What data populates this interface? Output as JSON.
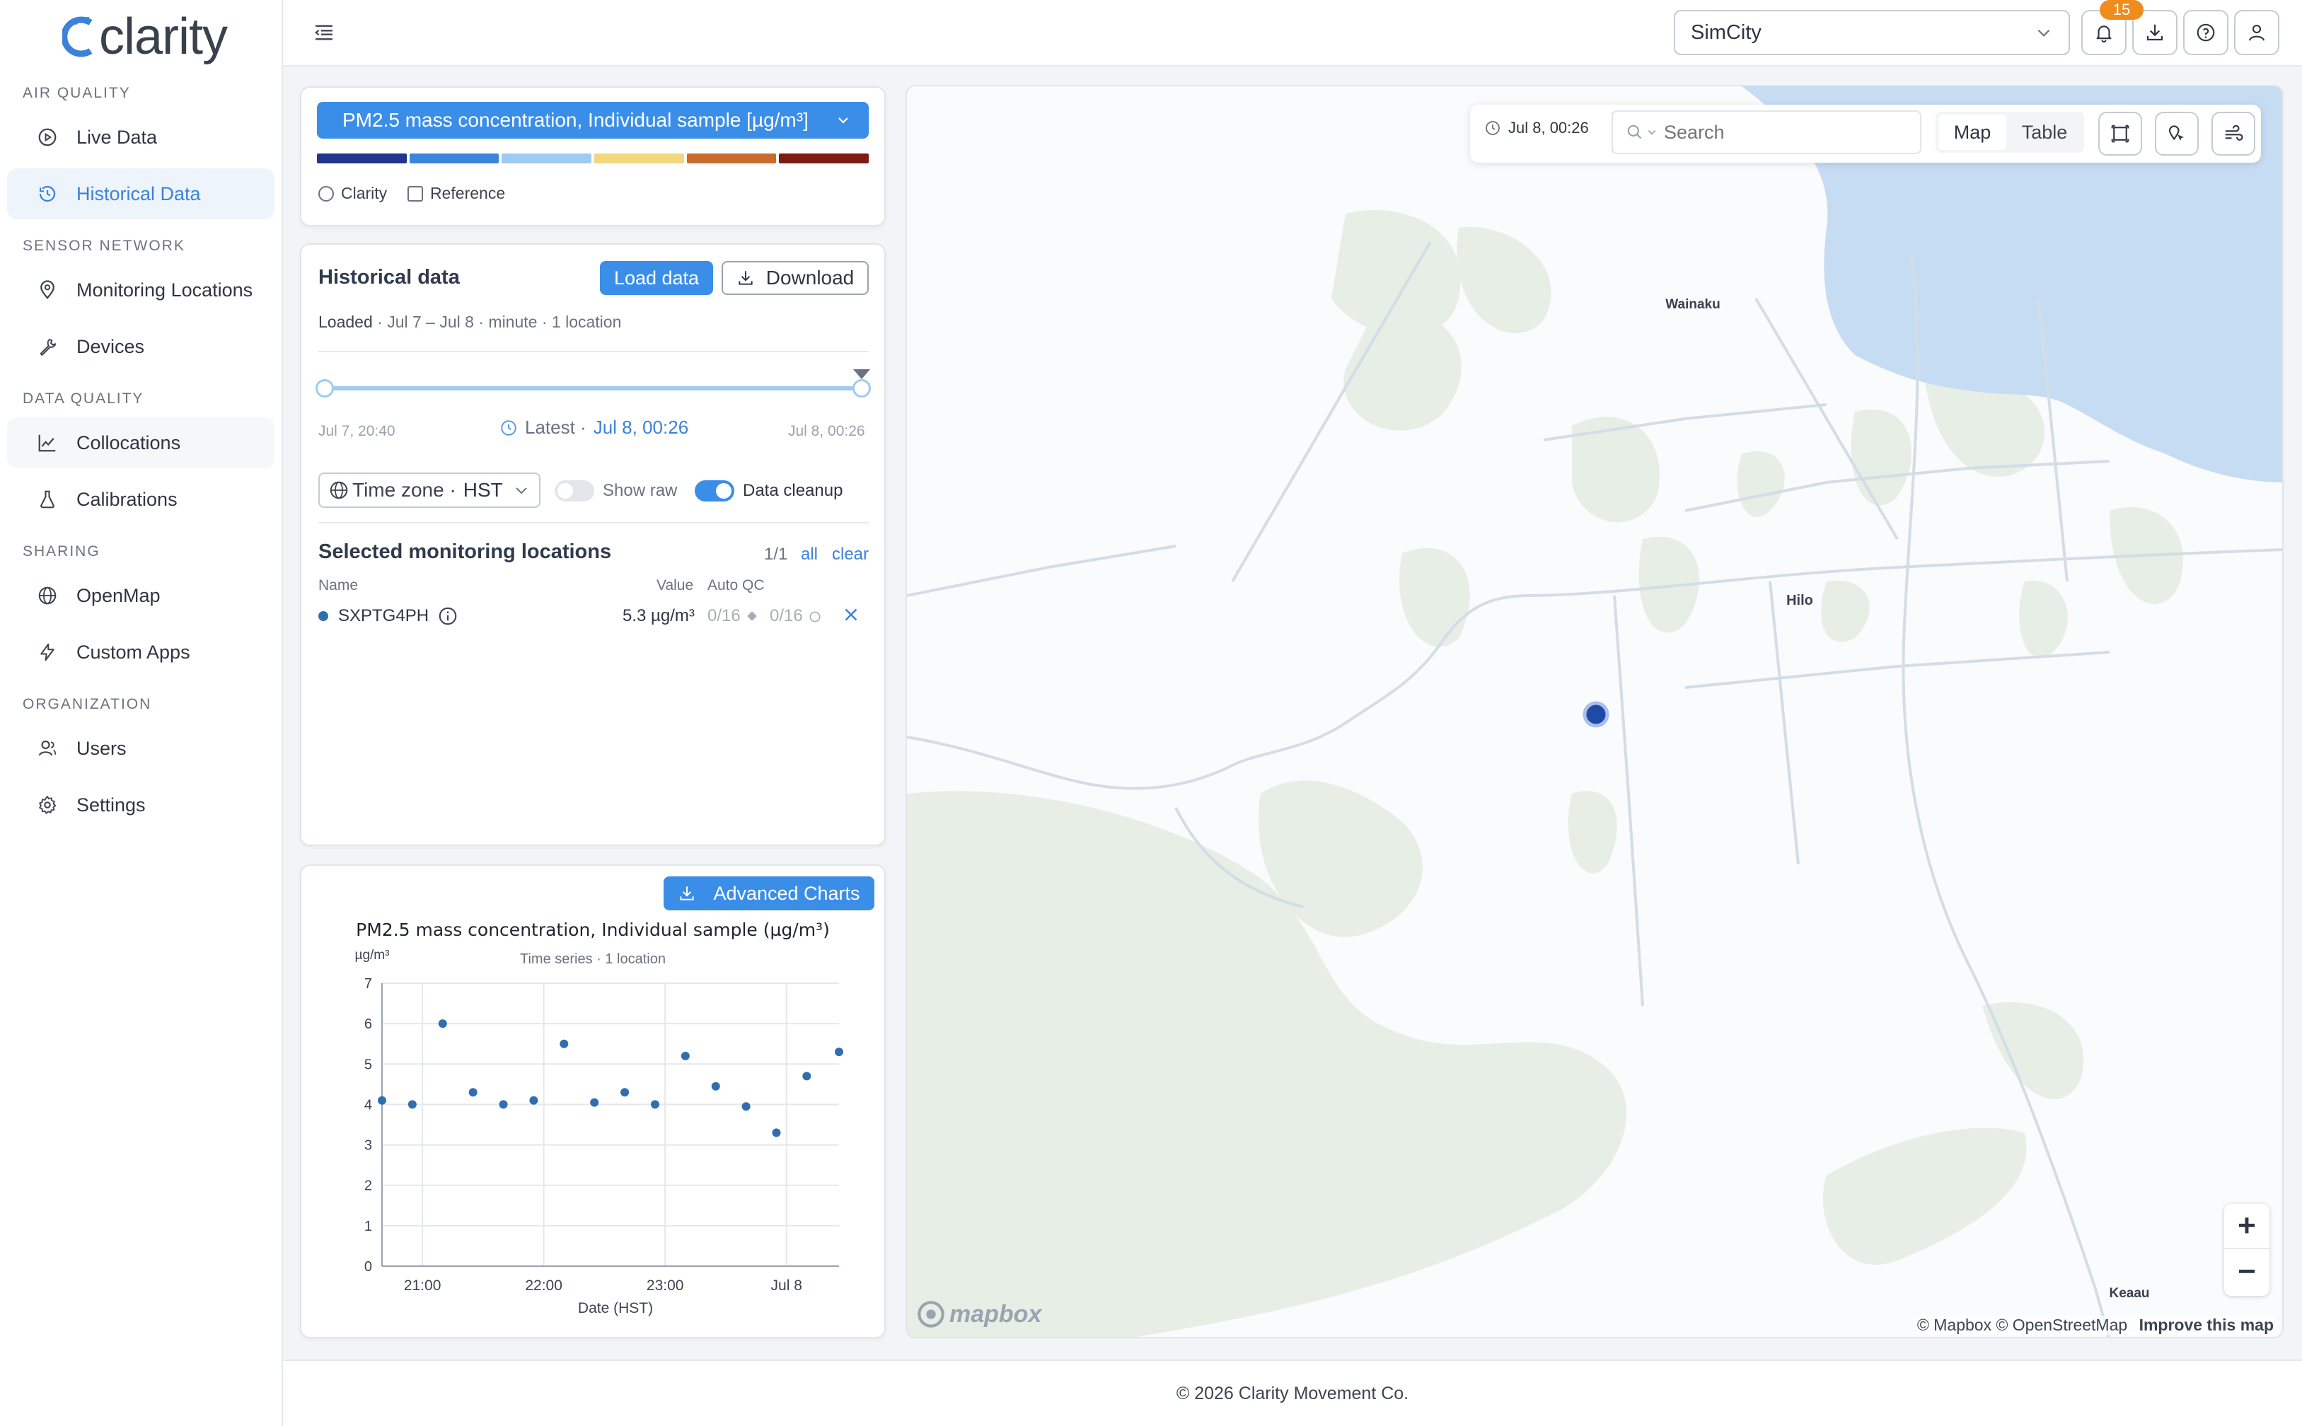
{
  "app": {
    "brand": "clarity"
  },
  "sidebar": {
    "sections": [
      {
        "title": "AIR QUALITY",
        "items": [
          {
            "label": "Live Data",
            "icon": "play-circle-icon"
          },
          {
            "label": "Historical Data",
            "icon": "history-icon",
            "active": true
          }
        ]
      },
      {
        "title": "SENSOR NETWORK",
        "items": [
          {
            "label": "Monitoring Locations",
            "icon": "map-pin-icon"
          },
          {
            "label": "Devices",
            "icon": "wrench-icon"
          }
        ]
      },
      {
        "title": "DATA QUALITY",
        "items": [
          {
            "label": "Collocations",
            "icon": "line-chart-icon"
          },
          {
            "label": "Calibrations",
            "icon": "flask-icon"
          }
        ]
      },
      {
        "title": "SHARING",
        "items": [
          {
            "label": "OpenMap",
            "icon": "globe-icon"
          },
          {
            "label": "Custom Apps",
            "icon": "bolt-icon"
          }
        ]
      },
      {
        "title": "ORGANIZATION",
        "items": [
          {
            "label": "Users",
            "icon": "users-icon"
          },
          {
            "label": "Settings",
            "icon": "gear-icon"
          }
        ]
      }
    ]
  },
  "topbar": {
    "org_select": "SimCity",
    "notifications_count": "15"
  },
  "metric": {
    "label": "PM2.5 mass concentration, Individual sample [µg/m³]",
    "scale_colors": [
      "#23348f",
      "#3a86dd",
      "#9ecbf0",
      "#f3d77c",
      "#c96b2c",
      "#7e1b14"
    ],
    "source_clarity": "Clarity",
    "source_reference": "Reference"
  },
  "historical": {
    "title": "Historical data",
    "load_button": "Load data",
    "download_button": "Download",
    "status": "Loaded",
    "range": "Jul 7 – Jul 8",
    "interval": "minute",
    "locations": "1 location",
    "slider_start": "Jul 7, 20:40",
    "slider_end": "Jul 8, 00:26",
    "latest_label": "Latest ·",
    "latest_value": "Jul 8, 00:26",
    "timezone_label": "Time zone ·",
    "timezone_value": "HST",
    "show_raw": "Show raw",
    "data_cleanup": "Data cleanup",
    "selected_title": "Selected monitoring locations",
    "selected_count": "1/1",
    "all_link": "all",
    "clear_link": "clear",
    "col_name": "Name",
    "col_value": "Value",
    "col_autoqc": "Auto QC",
    "row": {
      "name": "SXPTG4PH",
      "value": "5.3 µg/m³",
      "qc1": "0/16",
      "qc2": "0/16"
    }
  },
  "chart_panel": {
    "advanced_button": "Advanced Charts"
  },
  "chart_data": {
    "type": "scatter",
    "title": "PM2.5 mass concentration, Individual sample (µg/m³)",
    "subtitle": "Time series · 1 location",
    "ylabel": "µg/m³",
    "xlabel": "Date (HST)",
    "ylim": [
      0,
      7
    ],
    "yticks": [
      "0",
      "1",
      "2",
      "3",
      "4",
      "5",
      "6",
      "7"
    ],
    "xticks": [
      "21:00",
      "22:00",
      "23:00",
      "Jul 8"
    ],
    "xtick_positions": [
      21,
      22,
      23,
      24
    ],
    "xlim": [
      20.667,
      24.433
    ],
    "grid": true,
    "color": "#2f6fb0",
    "x": [
      20.667,
      20.917,
      21.167,
      21.417,
      21.667,
      21.917,
      22.167,
      22.417,
      22.667,
      22.917,
      23.167,
      23.417,
      23.667,
      23.917,
      24.167,
      24.433
    ],
    "y": [
      4.1,
      4.0,
      6.0,
      4.3,
      4.0,
      4.1,
      5.5,
      4.05,
      4.3,
      4.0,
      5.2,
      4.45,
      3.95,
      3.3,
      4.7,
      5.3
    ]
  },
  "map": {
    "time": "Jul 8, 00:26",
    "search_placeholder": "Search",
    "tab_map": "Map",
    "tab_table": "Table",
    "places": {
      "wainaku": "Wainaku",
      "hilo": "Hilo",
      "keaau": "Keaau"
    },
    "attribution": "© Mapbox © OpenStreetMap",
    "improve": "Improve this map",
    "mapbox_logo": "mapbox",
    "zoom_in": "+",
    "zoom_out": "−",
    "colors": {
      "water": "#c6dcf3",
      "green": "#e6eee6",
      "road": "#d3dde7",
      "marker": "#1f4aa8"
    }
  },
  "footer": {
    "copyright": "© 2026 Clarity Movement Co."
  }
}
